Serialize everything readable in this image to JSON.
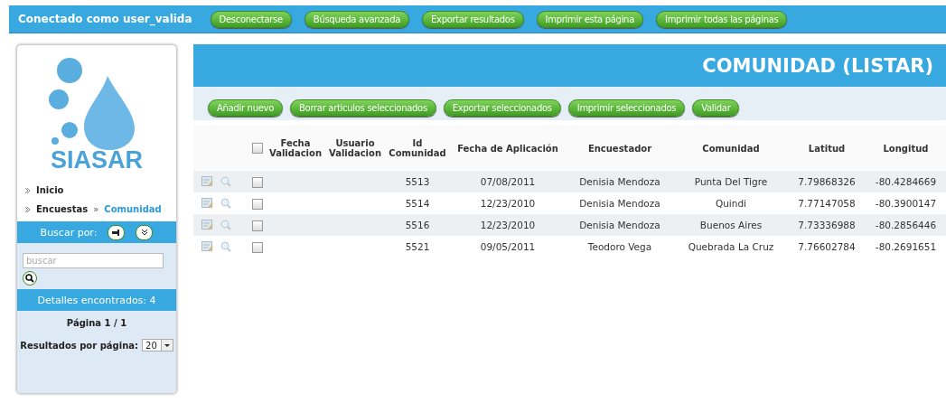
{
  "top_bar": {
    "user_label": "Conectado como user_valida",
    "buttons": [
      "Desconectarse",
      "Búsqueda avanzada",
      "Exportar resultados",
      "Imprimir esta página",
      "Imprimir todas las páginas"
    ]
  },
  "sidebar": {
    "logo_text": "SIASAR",
    "nav": [
      {
        "label": "Inicio"
      },
      {
        "label": "Encuestas",
        "separator": "»",
        "current": "Comunidad"
      }
    ],
    "search": {
      "label": "Buscar por:",
      "placeholder": "buscar"
    },
    "results": "Detalles encontrados: 4",
    "page": "Página 1 / 1",
    "per_page": {
      "label": "Resultados por página:",
      "value": "20"
    }
  },
  "main": {
    "title": "COMUNIDAD (LISTAR)",
    "actions": [
      "Añadir nuevo",
      "Borrar articulos seleccionados",
      "Exportar seleccionados",
      "Imprimir seleccionados",
      "Validar"
    ],
    "table": {
      "select_all_checked": false,
      "columns": [
        "Fecha Validacion",
        "Usuario Validacion",
        "Id Comunidad",
        "Fecha de Aplicación",
        "Encuestador",
        "Comunidad",
        "Latitud",
        "Longitud"
      ],
      "rows": [
        {
          "checked": false,
          "cells": [
            "",
            "",
            "5513",
            "07/08/2011",
            "Denisia Mendoza",
            "Punta Del Tigre",
            "7.79868326",
            "-80.4284669"
          ]
        },
        {
          "checked": false,
          "cells": [
            "",
            "",
            "5514",
            "12/23/2010",
            "Denisia Mendoza",
            "Quindi",
            "7.77147058",
            "-80.3900147"
          ]
        },
        {
          "checked": false,
          "cells": [
            "",
            "",
            "5516",
            "12/23/2010",
            "Denisia Mendoza",
            "Buenos Aires",
            "7.73336988",
            "-80.2856446"
          ]
        },
        {
          "checked": false,
          "cells": [
            "",
            "",
            "5521",
            "09/05/2011",
            "Teodoro Vega",
            "Quebrada La Cruz",
            "7.76602784",
            "-80.2691651"
          ]
        }
      ]
    }
  }
}
